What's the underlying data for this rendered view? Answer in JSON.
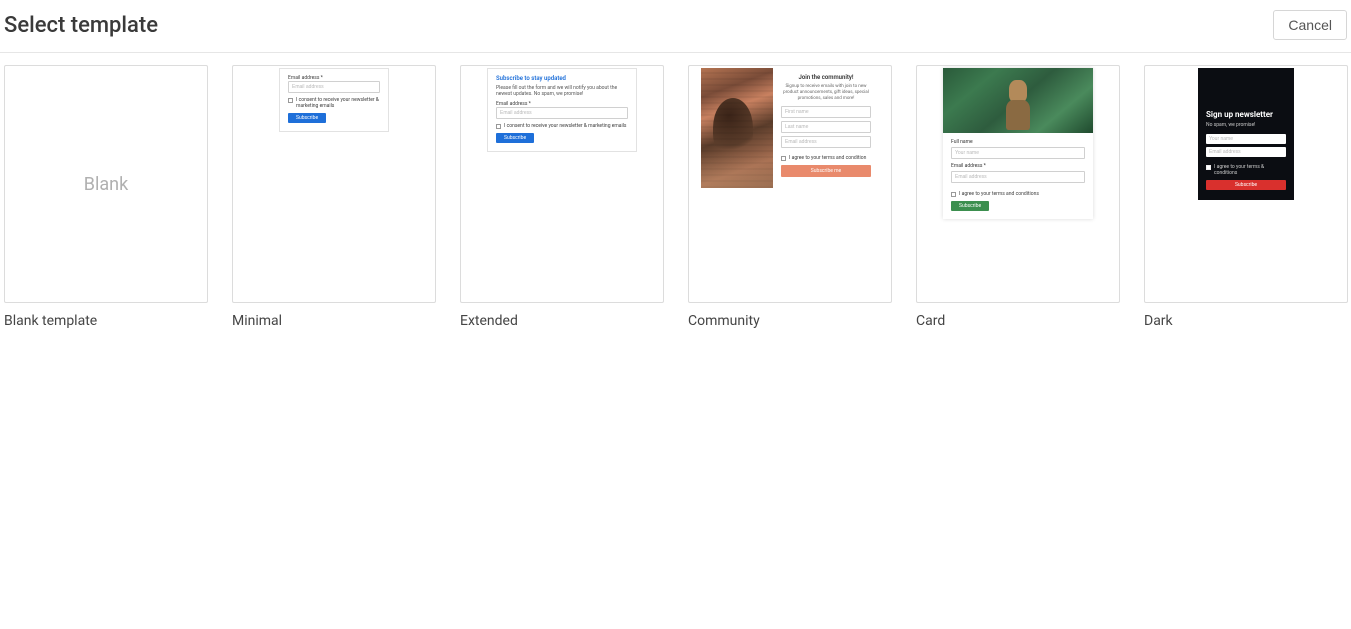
{
  "header": {
    "title": "Select template",
    "cancel_label": "Cancel"
  },
  "templates": [
    {
      "label": "Blank template",
      "thumb_text": "Blank"
    },
    {
      "label": "Minimal"
    },
    {
      "label": "Extended"
    },
    {
      "label": "Community"
    },
    {
      "label": "Card"
    },
    {
      "label": "Dark"
    }
  ],
  "preview": {
    "minimal": {
      "email_label": "Email address *",
      "email_placeholder": "Email address",
      "consent": "I consent to receive your newsletter & marketing emails",
      "button": "Subscribe"
    },
    "extended": {
      "title": "Subscribe to stay updated",
      "desc": "Please fill out the form and we will notify you about the newest updates. No spam, we promise!",
      "email_label": "Email address *",
      "email_placeholder": "Email address",
      "consent": "I consent to receive your newsletter & marketing emails",
      "button": "Subscribe"
    },
    "community": {
      "title": "Join the community!",
      "desc": "Signup to receive emails with join to new product announcements, gift ideas, special promotions, sales and more!",
      "first_placeholder": "First name",
      "last_placeholder": "Last name",
      "email_placeholder": "Email address",
      "consent": "I agree to your terms and condition",
      "button": "Subscribe me"
    },
    "card": {
      "name_label": "Full name",
      "name_placeholder": "Your name",
      "email_label": "Email address *",
      "email_placeholder": "Email address",
      "consent": "I agree to your terms and conditions",
      "button": "Subscribe"
    },
    "dark": {
      "title": "Sign up newsletter",
      "sub": "No spam, we promise!",
      "name_placeholder": "Your name",
      "email_placeholder": "Email address",
      "consent": "I agree to your terms & conditions",
      "button": "Subscribe"
    }
  }
}
